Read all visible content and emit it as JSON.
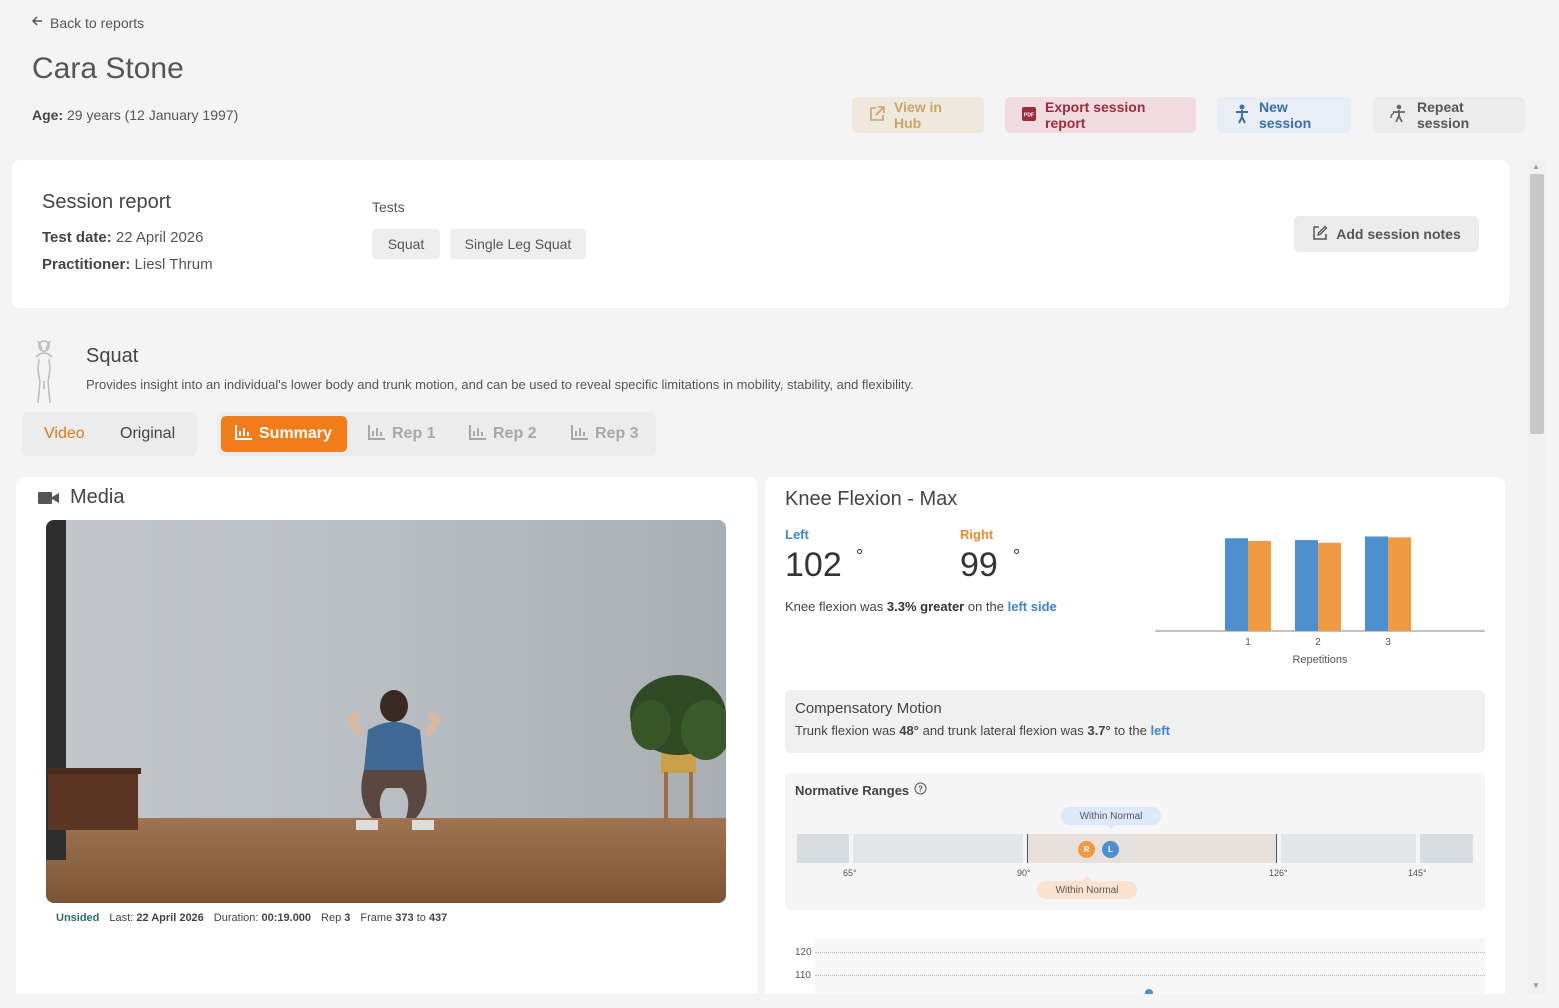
{
  "nav": {
    "back_label": "Back to reports"
  },
  "patient": {
    "name": "Cara Stone",
    "age_label": "Age:",
    "age_value": "29 years (12 January 1997)"
  },
  "actions": {
    "view_hub": "View in Hub",
    "export": "Export session report",
    "new_session": "New session",
    "repeat_session": "Repeat session"
  },
  "session": {
    "title": "Session report",
    "test_date_label": "Test date:",
    "test_date": "22 April 2026",
    "practitioner_label": "Practitioner:",
    "practitioner": "Liesl Thrum",
    "tests_label": "Tests",
    "tests": [
      "Squat",
      "Single Leg Squat"
    ],
    "add_notes": "Add session notes"
  },
  "test": {
    "title": "Squat",
    "description": "Provides insight into an individual's lower body and trunk motion, and can be used to reveal specific limitations in mobility, stability, and flexibility."
  },
  "view_toggle": {
    "video": "Video",
    "original": "Original"
  },
  "tabs": [
    "Summary",
    "Rep 1",
    "Rep 2",
    "Rep 3"
  ],
  "media": {
    "title": "Media",
    "side": "Unsided",
    "last_label": "Last:",
    "last": "22 April 2026",
    "duration_label": "Duration:",
    "duration": "00:19.000",
    "rep_label": "Rep",
    "rep": "3",
    "frame_label": "Frame",
    "frame_from": "373",
    "frame_to_label": "to",
    "frame_to": "437"
  },
  "knee": {
    "title": "Knee Flexion - Max",
    "left_label": "Left",
    "left_value": "102",
    "right_label": "Right",
    "right_value": "99",
    "unit": "°",
    "summary_prefix": "Knee flexion was",
    "summary_pct": "3.3% greater",
    "summary_mid": "on the",
    "summary_side": "left side"
  },
  "chart_data": {
    "type": "bar",
    "categories": [
      "1",
      "2",
      "3"
    ],
    "series": [
      {
        "name": "Left",
        "values": [
          102,
          100,
          104
        ]
      },
      {
        "name": "Right",
        "values": [
          99,
          97,
          103
        ]
      }
    ],
    "xlabel": "Repetitions",
    "ylabel": "",
    "ylim": [
      0,
      110
    ]
  },
  "compensatory": {
    "title": "Compensatory Motion",
    "p1": "Trunk flexion was",
    "trunk_flexion": "48°",
    "p2": "and trunk lateral flexion was",
    "lateral": "3.7°",
    "p3": "to the",
    "side": "left"
  },
  "normative": {
    "title": "Normative Ranges",
    "pill_top": "Within Normal",
    "pill_bottom": "Within Normal",
    "ticks": [
      "65°",
      "90°",
      "126°",
      "145°"
    ],
    "marker_r": "R",
    "marker_l": "L"
  },
  "lower_chart": {
    "y_ticks": [
      "120",
      "110"
    ]
  },
  "colors": {
    "left": "#4e8fd0",
    "right": "#f19a44",
    "accent": "#f07d1a"
  }
}
